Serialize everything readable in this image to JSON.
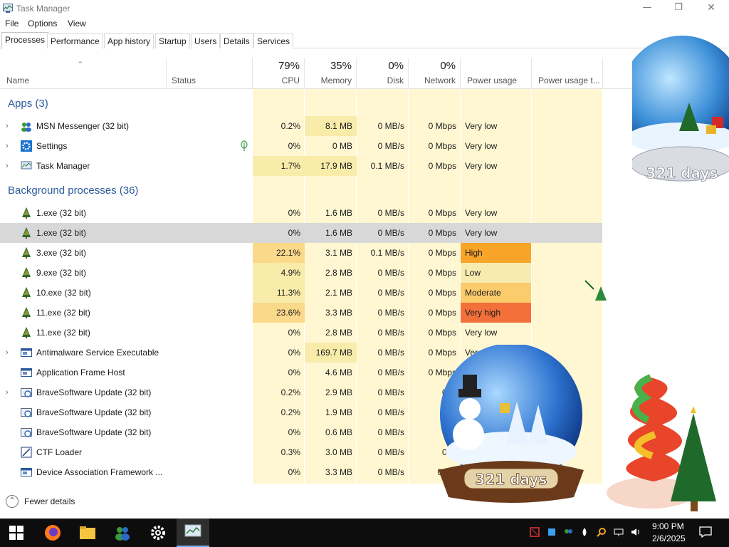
{
  "window": {
    "title": "Task Manager"
  },
  "menu": [
    "File",
    "Options",
    "View"
  ],
  "tabs": [
    "Processes",
    "Performance",
    "App history",
    "Startup",
    "Users",
    "Details",
    "Services"
  ],
  "columns": {
    "name": "Name",
    "status": "Status",
    "cpu": {
      "pct": "79%",
      "label": "CPU"
    },
    "memory": {
      "pct": "35%",
      "label": "Memory"
    },
    "disk": {
      "pct": "0%",
      "label": "Disk"
    },
    "network": {
      "pct": "0%",
      "label": "Network"
    },
    "power": "Power usage",
    "power_trend": "Power usage t..."
  },
  "sections": {
    "apps": "Apps (3)",
    "background": "Background processes (36)"
  },
  "apps": [
    {
      "name": "MSN Messenger (32 bit)",
      "cpu": "0.2%",
      "memory": "8.1 MB",
      "disk": "0 MB/s",
      "network": "0 Mbps",
      "power": "Very low",
      "icon": "msn-icon"
    },
    {
      "name": "Settings",
      "cpu": "0%",
      "memory": "0 MB",
      "disk": "0 MB/s",
      "network": "0 Mbps",
      "power": "Very low",
      "icon": "gear-icon"
    },
    {
      "name": "Task Manager",
      "cpu": "1.7%",
      "memory": "17.9 MB",
      "disk": "0.1 MB/s",
      "network": "0 Mbps",
      "power": "Very low",
      "icon": "taskmanager-icon"
    }
  ],
  "background": [
    {
      "name": "1.exe (32 bit)",
      "cpu": "0%",
      "memory": "1.6 MB",
      "disk": "0 MB/s",
      "network": "0 Mbps",
      "power": "Very low",
      "icon": "tree-icon"
    },
    {
      "name": "1.exe (32 bit)",
      "cpu": "0%",
      "memory": "1.6 MB",
      "disk": "0 MB/s",
      "network": "0 Mbps",
      "power": "Very low",
      "icon": "tree-icon"
    },
    {
      "name": "3.exe (32 bit)",
      "cpu": "22.1%",
      "memory": "3.1 MB",
      "disk": "0.1 MB/s",
      "network": "0 Mbps",
      "power": "High",
      "icon": "tree-icon"
    },
    {
      "name": "9.exe (32 bit)",
      "cpu": "4.9%",
      "memory": "2.8 MB",
      "disk": "0 MB/s",
      "network": "0 Mbps",
      "power": "Low",
      "icon": "tree-icon"
    },
    {
      "name": "10.exe (32 bit)",
      "cpu": "11.3%",
      "memory": "2.1 MB",
      "disk": "0 MB/s",
      "network": "0 Mbps",
      "power": "Moderate",
      "icon": "tree-icon"
    },
    {
      "name": "11.exe (32 bit)",
      "cpu": "23.6%",
      "memory": "3.3 MB",
      "disk": "0 MB/s",
      "network": "0 Mbps",
      "power": "Very high",
      "icon": "tree-icon"
    },
    {
      "name": "11.exe (32 bit)",
      "cpu": "0%",
      "memory": "2.8 MB",
      "disk": "0 MB/s",
      "network": "0 Mbps",
      "power": "Very low",
      "icon": "tree-icon"
    },
    {
      "name": "Antimalware Service Executable",
      "cpu": "0%",
      "memory": "169.7 MB",
      "disk": "0 MB/s",
      "network": "0 Mbps",
      "power": "Ver",
      "icon": "service-icon"
    },
    {
      "name": "Application Frame Host",
      "cpu": "0%",
      "memory": "4.6 MB",
      "disk": "0 MB/s",
      "network": "0 Mbps",
      "power": "",
      "icon": "service-icon"
    },
    {
      "name": "BraveSoftware Update (32 bit)",
      "cpu": "0.2%",
      "memory": "2.9 MB",
      "disk": "0 MB/s",
      "network": "0 M",
      "power": "",
      "icon": "update-icon"
    },
    {
      "name": "BraveSoftware Update (32 bit)",
      "cpu": "0.2%",
      "memory": "1.9 MB",
      "disk": "0 MB/s",
      "network": "0 N",
      "power": "",
      "icon": "update-icon"
    },
    {
      "name": "BraveSoftware Update (32 bit)",
      "cpu": "0%",
      "memory": "0.6 MB",
      "disk": "0 MB/s",
      "network": "0 M",
      "power": "",
      "icon": "update-icon"
    },
    {
      "name": "CTF Loader",
      "cpu": "0.3%",
      "memory": "3.0 MB",
      "disk": "0 MB/s",
      "network": "0 M",
      "power": "",
      "icon": "ctf-icon"
    },
    {
      "name": "Device Association Framework ...",
      "cpu": "0%",
      "memory": "3.3 MB",
      "disk": "0 MB/s",
      "network": "0 Mb",
      "power": "",
      "icon": "service-icon"
    }
  ],
  "footer": {
    "fewer_details": "Fewer details"
  },
  "desktop": {
    "globe_top_text": "321 days",
    "globe_bottom_text": "321 days"
  },
  "taskbar": {
    "time": "9:00 PM",
    "date": "2/6/2025"
  },
  "colors": {
    "section_title": "#2a5a9a",
    "selected_row": "#d8d8d8",
    "power_high": "#f7a428",
    "power_very_high": "#f3703a",
    "power_moderate": "#fbcc6c"
  }
}
